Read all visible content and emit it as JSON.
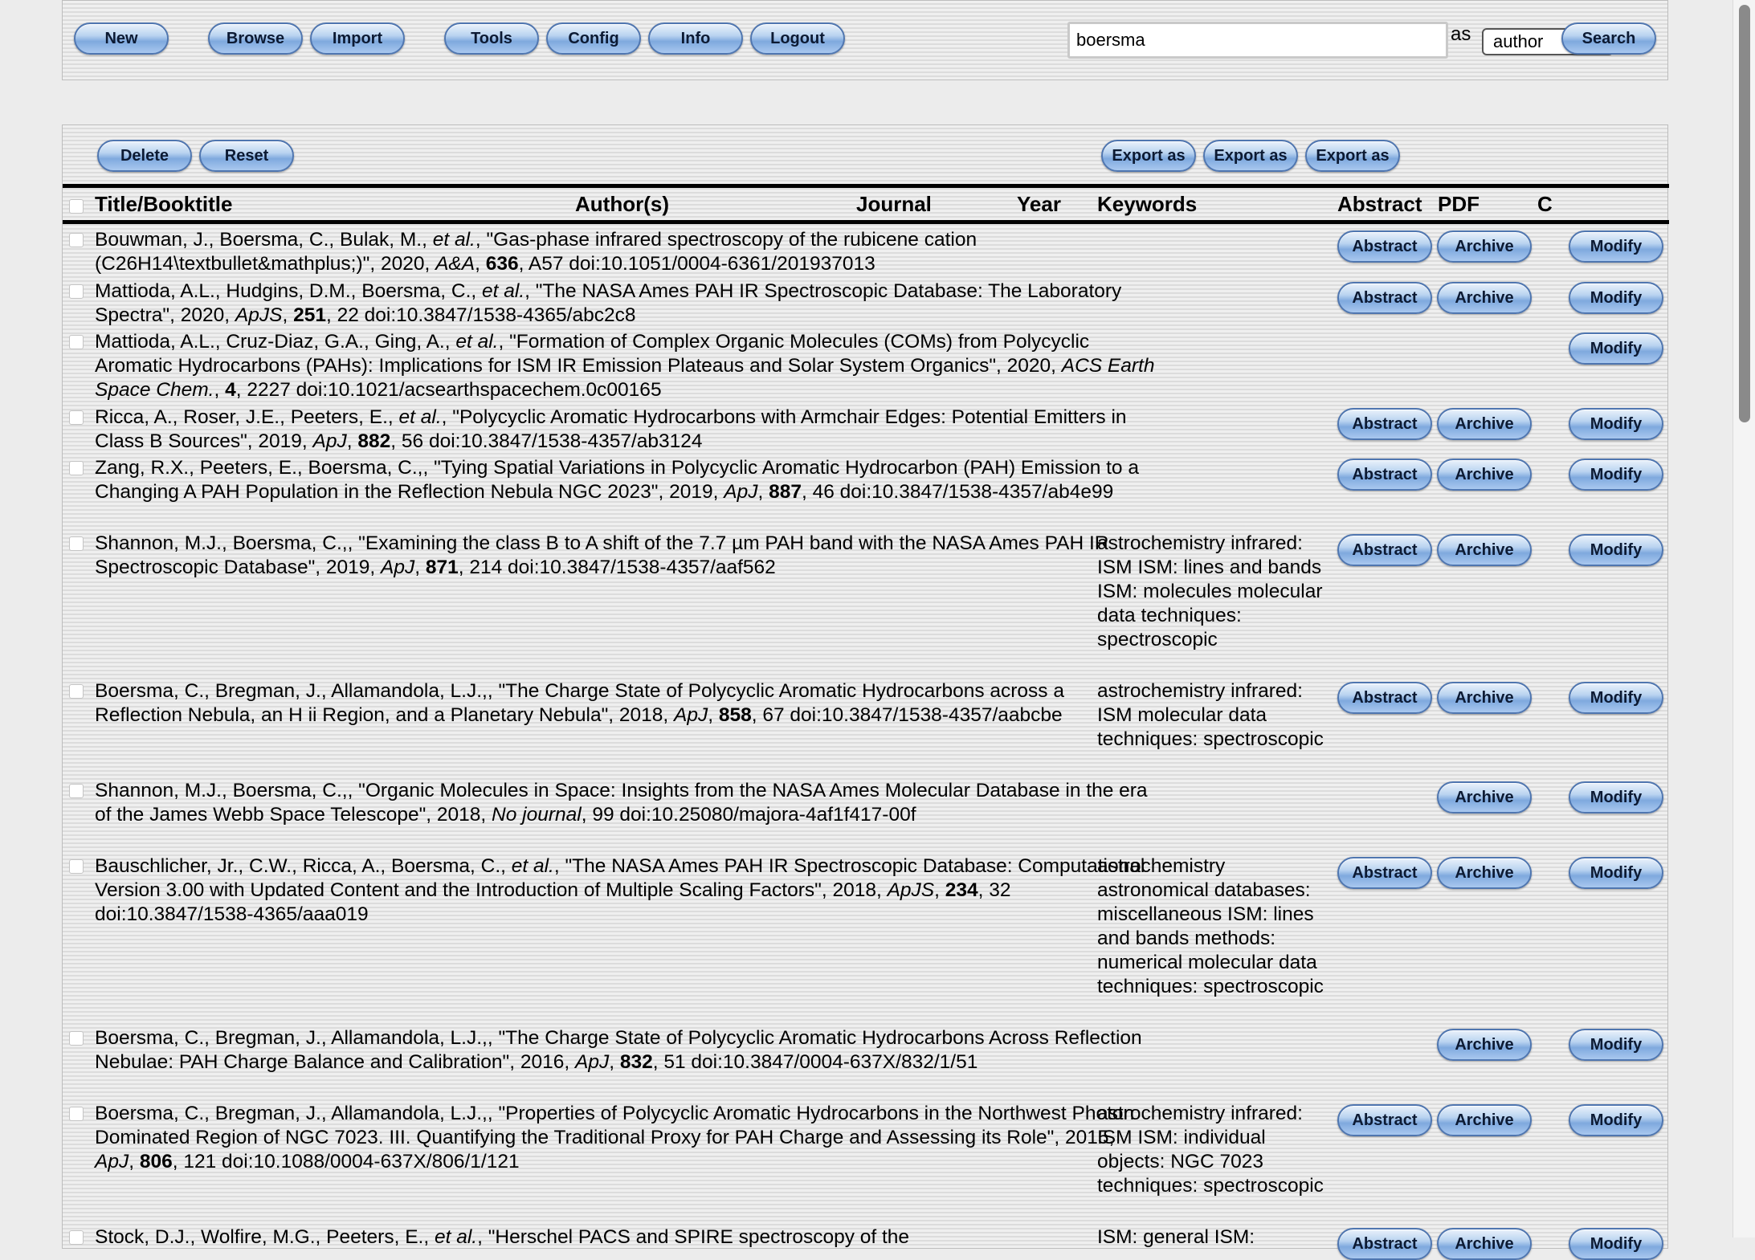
{
  "toolbar": {
    "buttons": {
      "new": "New",
      "browse": "Browse",
      "import": "Import",
      "tools": "Tools",
      "config": "Config",
      "info": "Info",
      "logout": "Logout",
      "search": "Search"
    },
    "search_value": "boersma",
    "as_label": "as",
    "search_field_selected": "author"
  },
  "actions": {
    "delete": "Delete",
    "reset": "Reset",
    "export1": "Export as",
    "export2": "Export as",
    "export3": "Export as"
  },
  "columns": {
    "title": "Title/Booktitle",
    "authors": "Author(s)",
    "journal": "Journal",
    "year": "Year",
    "keywords": "Keywords",
    "abstract": "Abstract",
    "pdf": "PDF",
    "c": "C"
  },
  "button_labels": {
    "abstract": "Abstract",
    "archive": "Archive",
    "modify": "Modify"
  },
  "rows": [
    {
      "authors": "Bouwman, J., Boersma, C., Bulak, M., ",
      "etal": "et al.",
      "title": ", \"Gas-phase infrared spectroscopy of the rubicene cation (C26H14\\textbullet&mathplus;)\", 2020, ",
      "journal": "A&A",
      "sep1": ", ",
      "volume": "636",
      "rest": ", A57 doi:10.1051/0004-6361/201937013",
      "keywords": "",
      "abstract": true,
      "archive": true
    },
    {
      "authors": "Mattioda, A.L., Hudgins, D.M., Boersma, C., ",
      "etal": "et al.",
      "title": ", \"The NASA Ames PAH IR Spectroscopic Database: The Laboratory Spectra\", 2020, ",
      "journal": "ApJS",
      "sep1": ", ",
      "volume": "251",
      "rest": ", 22 doi:10.3847/1538-4365/abc2c8",
      "keywords": "",
      "abstract": true,
      "archive": true
    },
    {
      "authors": "Mattioda, A.L., Cruz-Diaz, G.A., Ging, A., ",
      "etal": "et al.",
      "title": ", \"Formation of Complex Organic Molecules (COMs) from Polycyclic Aromatic Hydrocarbons (PAHs): Implications for ISM IR Emission Plateaus and Solar System Organics\", 2020, ",
      "journal": "ACS Earth Space Chem.",
      "sep1": ", ",
      "volume": "4",
      "rest": ", 2227 doi:10.1021/acsearthspacechem.0c00165",
      "keywords": "",
      "abstract": false,
      "archive": false
    },
    {
      "authors": "Ricca, A., Roser, J.E., Peeters, E., ",
      "etal": "et al.",
      "title": ", \"Polycyclic Aromatic Hydrocarbons with Armchair Edges: Potential Emitters in Class B Sources\", 2019, ",
      "journal": "ApJ",
      "sep1": ", ",
      "volume": "882",
      "rest": ", 56 doi:10.3847/1538-4357/ab3124",
      "keywords": "",
      "abstract": true,
      "archive": true
    },
    {
      "authors": "Zang, R.X., Peeters, E., Boersma, C.,",
      "etal": "",
      "title": ", \"Tying Spatial Variations in Polycyclic Aromatic Hydrocarbon (PAH) Emission to a Changing A PAH Population in the Reflection Nebula NGC 2023\", 2019, ",
      "journal": "ApJ",
      "sep1": ", ",
      "volume": "887",
      "rest": ", 46 doi:10.3847/1538-4357/ab4e99",
      "keywords": "",
      "abstract": true,
      "archive": true
    },
    {
      "authors": "Shannon, M.J., Boersma, C.,",
      "etal": "",
      "title": ", \"Examining the class B to A shift of the 7.7 µm PAH band with the NASA Ames PAH IR Spectroscopic Database\", 2019, ",
      "journal": "ApJ",
      "sep1": ", ",
      "volume": "871",
      "rest": ", 214 doi:10.3847/1538-4357/aaf562",
      "keywords": "astrochemistry infrared: ISM ISM: lines and bands ISM: molecules molecular data techniques: spectroscopic",
      "abstract": true,
      "archive": true
    },
    {
      "authors": "Boersma, C., Bregman, J., Allamandola, L.J.,",
      "etal": "",
      "title": ", \"The Charge State of Polycyclic Aromatic Hydrocarbons across a Reflection Nebula, an H ii Region, and a Planetary Nebula\", 2018, ",
      "journal": "ApJ",
      "sep1": ", ",
      "volume": "858",
      "rest": ", 67 doi:10.3847/1538-4357/aabcbe",
      "keywords": "astrochemistry infrared: ISM molecular data techniques: spectroscopic",
      "abstract": true,
      "archive": true
    },
    {
      "authors": "Shannon, M.J., Boersma, C.,",
      "etal": "",
      "title": ", \"Organic Molecules in Space: Insights from the NASA Ames Molecular Database in the era of the James Webb Space Telescope\", 2018, ",
      "journal": "No journal",
      "sep1": ", ",
      "volume": "",
      "rest": "99 doi:10.25080/majora-4af1f417-00f",
      "keywords": "",
      "abstract": false,
      "archive": true
    },
    {
      "authors": "Bauschlicher, Jr., C.W., Ricca, A., Boersma, C., ",
      "etal": "et al.",
      "title": ", \"The NASA Ames PAH IR Spectroscopic Database: Computational Version 3.00 with Updated Content and the Introduction of Multiple Scaling Factors\", 2018, ",
      "journal": "ApJS",
      "sep1": ", ",
      "volume": "234",
      "rest": ", 32 doi:10.3847/1538-4365/aaa019",
      "keywords": "astrochemistry astronomical databases: miscellaneous ISM: lines and bands methods: numerical molecular data techniques: spectroscopic",
      "abstract": true,
      "archive": true
    },
    {
      "authors": "Boersma, C., Bregman, J., Allamandola, L.J.,",
      "etal": "",
      "title": ", \"The Charge State of Polycyclic Aromatic Hydrocarbons Across Reflection Nebulae: PAH Charge Balance and Calibration\", 2016, ",
      "journal": "ApJ",
      "sep1": ", ",
      "volume": "832",
      "rest": ", 51 doi:10.3847/0004-637X/832/1/51",
      "keywords": "",
      "abstract": false,
      "archive": true
    },
    {
      "authors": "Boersma, C., Bregman, J., Allamandola, L.J.,",
      "etal": "",
      "title": ", \"Properties of Polycyclic Aromatic Hydrocarbons in the Northwest Photon Dominated Region of NGC 7023. III. Quantifying the Traditional Proxy for PAH Charge and Assessing its Role\", 2015, ",
      "journal": "ApJ",
      "sep1": ", ",
      "volume": "806",
      "rest": ", 121 doi:10.1088/0004-637X/806/1/121",
      "keywords": "astrochemistry infrared: ISM ISM: individual objects: NGC 7023 techniques: spectroscopic",
      "abstract": true,
      "archive": true
    },
    {
      "authors": "Stock, D.J., Wolfire, M.G., Peeters, E., ",
      "etal": "et al.",
      "title": ", \"Herschel PACS and SPIRE spectroscopy of the",
      "journal": "",
      "sep1": "",
      "volume": "",
      "rest": "",
      "keywords": "ISM: general ISM:",
      "abstract": true,
      "archive": true
    }
  ]
}
